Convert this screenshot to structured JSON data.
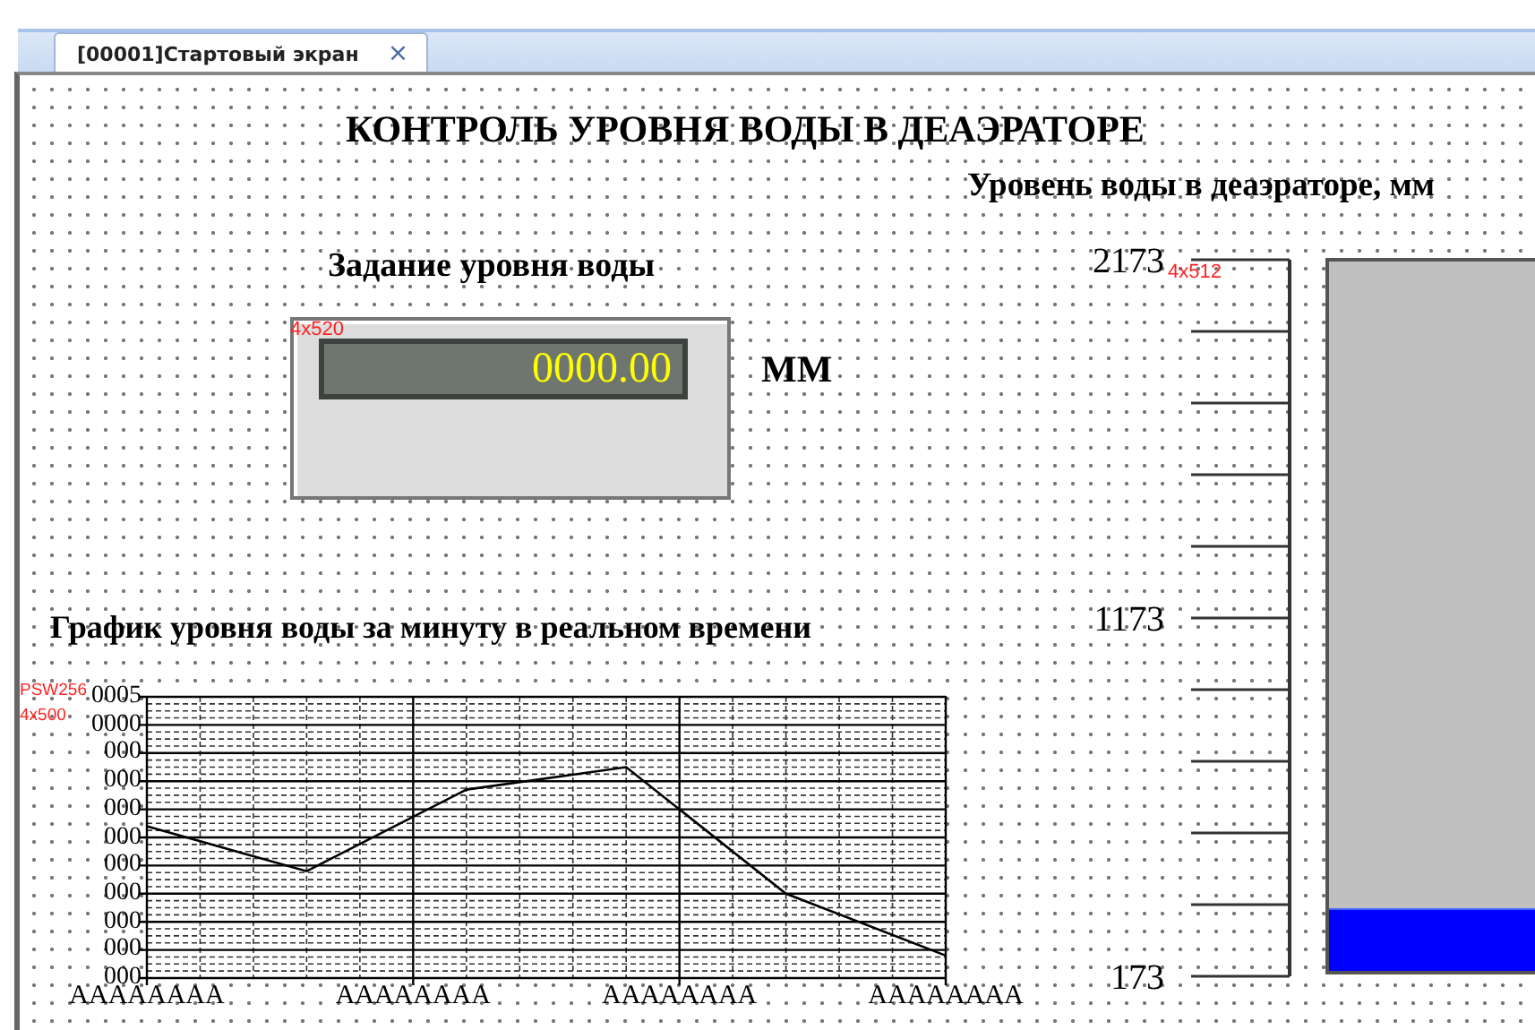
{
  "tab": {
    "label": "[00001]Стартовый экран",
    "close": "×",
    "selected": true
  },
  "title": "КОНТРОЛЬ УРОВНЯ ВОДЫ В ДЕАЭРАТОРЕ",
  "setpoint": {
    "heading": "Задание уровня воды",
    "tag": "4x520",
    "value": "0000.00",
    "unit": "ММ"
  },
  "trend": {
    "heading": "График уровня воды за минуту в реальном времени",
    "tags": [
      "PSW256",
      "4x500"
    ],
    "y_labels": [
      "0005",
      "0000",
      "000",
      "000",
      "000",
      "000",
      "000",
      "000",
      "000",
      "000",
      "000"
    ],
    "x_labels": [
      "AAAAAAAA",
      "AAAAAAAA",
      "AAAAAAAA",
      "AAAAAAAA"
    ]
  },
  "level_bar": {
    "heading": "Уровень воды в деаэраторе, мм",
    "tag": "4x512",
    "scale": [
      "2173",
      "1173",
      "173"
    ],
    "level": 0.087
  }
}
